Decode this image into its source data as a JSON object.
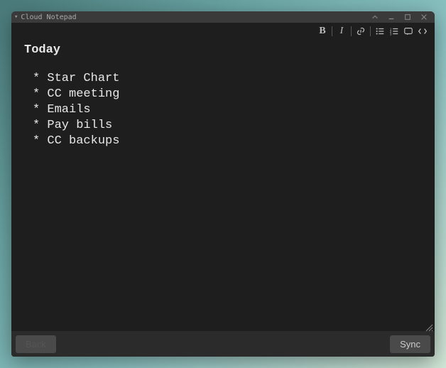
{
  "window": {
    "title": "Cloud Notepad"
  },
  "toolbar": {
    "bold": "B",
    "italic": "I",
    "link": "link",
    "ul": "ul",
    "ol": "ol",
    "quote": "quote",
    "code": "code"
  },
  "document": {
    "heading": "Today",
    "items": [
      "Star Chart",
      "CC meeting",
      "Emails",
      "Pay bills",
      "CC backups"
    ],
    "bullet": " * "
  },
  "footer": {
    "back_label": "Back",
    "sync_label": "Sync"
  }
}
